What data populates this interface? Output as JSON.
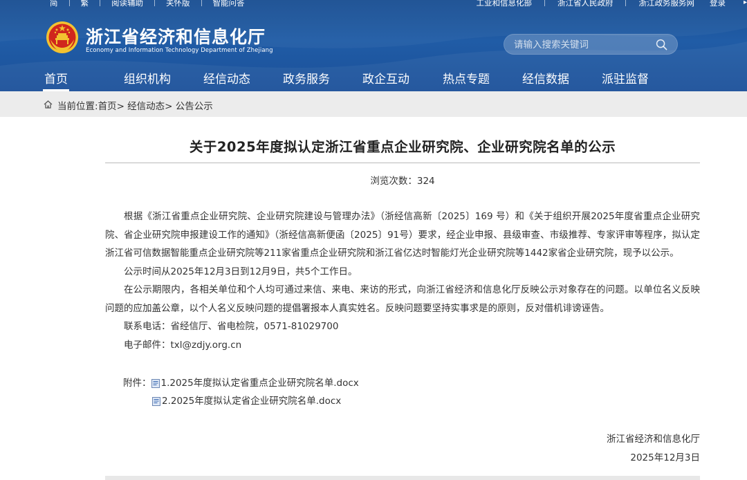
{
  "colors": {
    "header_bg": "#1d559d",
    "breadcrumb_bg": "#ececec",
    "emblem_red": "#d0261d",
    "emblem_gold": "#f2c230"
  },
  "topbar": {
    "left_links": [
      "简",
      "繁",
      "阅读辅助",
      "关怀版",
      "智能问答"
    ],
    "right_links": [
      "工业和信息化部",
      "浙江省人民政府",
      "浙江政务服务网"
    ],
    "login_label": "登录"
  },
  "site": {
    "title_cn": "浙江省经济和信息化厅",
    "title_en": "Economy and Information Technology Department of Zhejiang",
    "logo_icon": "national-emblem-icon"
  },
  "search": {
    "placeholder": "请输入搜索关键词",
    "icon": "search-icon"
  },
  "nav": {
    "items": [
      "首页",
      "组织机构",
      "经信动态",
      "政务服务",
      "政企互动",
      "热点专题",
      "经信数据",
      "派驻监督"
    ],
    "active_index": 0
  },
  "breadcrumb": {
    "prefix": "当前位置:",
    "items": [
      "首页",
      "经信动态",
      "公告公示"
    ],
    "separator": "> "
  },
  "article": {
    "title": "关于2025年度拟认定浙江省重点企业研究院、企业研究院名单的公示",
    "views_label": "浏览次数：",
    "views_count": "324",
    "paragraphs": [
      "根据《浙江省重点企业研究院、企业研究院建设与管理办法》（浙经信高新〔2025〕169 号）和《关于组织开展2025年度省重点企业研究院、省企业研究院申报建设工作的通知》（浙经信高新便函〔2025〕91号）要求，经企业申报、县级审查、市级推荐、专家评审等程序，拟认定浙江省可信数据智能重点企业研究院等211家省重点企业研究院和浙江省亿达时智能灯光企业研究院等1442家省企业研究院，现予以公示。",
      "公示时间从2025年12月3日到12月9日，共5个工作日。",
      "在公示期限内，各相关单位和个人均可通过来信、来电、来访的形式，向浙江省经济和信息化厅反映公示对象存在的问题。以单位名义反映问题的应加盖公章，以个人名义反映问题的提倡署报本人真实姓名。反映问题要坚持实事求是的原则，反对借机诽谤诬告。",
      "联系电话：省经信厅、省电检院，0571-81029700",
      "电子邮件：txl@zdjy.org.cn"
    ],
    "attachments_label": "附件：",
    "attachments": [
      "1.2025年度拟认定省重点企业研究院名单.docx",
      "2.2025年度拟认定省企业研究院名单.docx"
    ],
    "signature_org": "浙江省经济和信息化厅",
    "signature_date": "2025年12月3日"
  }
}
